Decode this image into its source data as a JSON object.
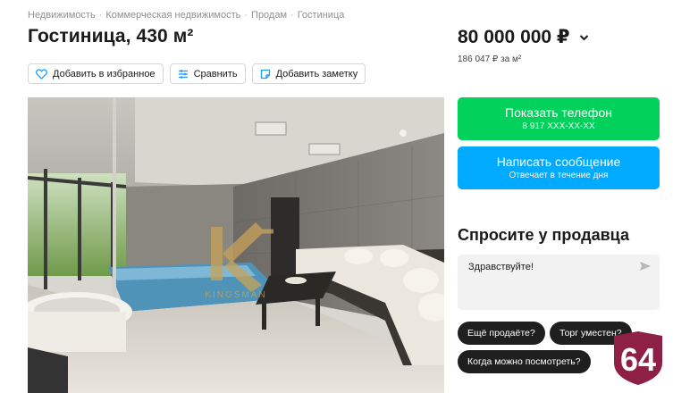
{
  "breadcrumbs": [
    "Недвижимость",
    "Коммерческая недвижимость",
    "Продам",
    "Гостиница"
  ],
  "title": "Гостиница, 430 м²",
  "actions": {
    "favorite": "Добавить в избранное",
    "compare": "Сравнить",
    "note": "Добавить заметку"
  },
  "price": {
    "value": "80 000 000 ₽",
    "per_meter": "186 047 ₽ за м²"
  },
  "phone_button": {
    "label": "Показать телефон",
    "number": "8 917 XXX-XX-XX"
  },
  "message_button": {
    "label": "Написать сообщение",
    "sub": "Отвечает в течение дня"
  },
  "ask": {
    "title": "Спросите у продавца",
    "text": "Здравствуйте!",
    "chips": [
      "Ещё продаёте?",
      "Торг уместен?",
      "Когда можно посмотреть?"
    ]
  },
  "badge": {
    "number": "64"
  },
  "photo": {
    "watermark": "KINGSMAN"
  },
  "colors": {
    "green": "#02d15c",
    "blue": "#00aaff",
    "badge": "#8e1f45"
  }
}
